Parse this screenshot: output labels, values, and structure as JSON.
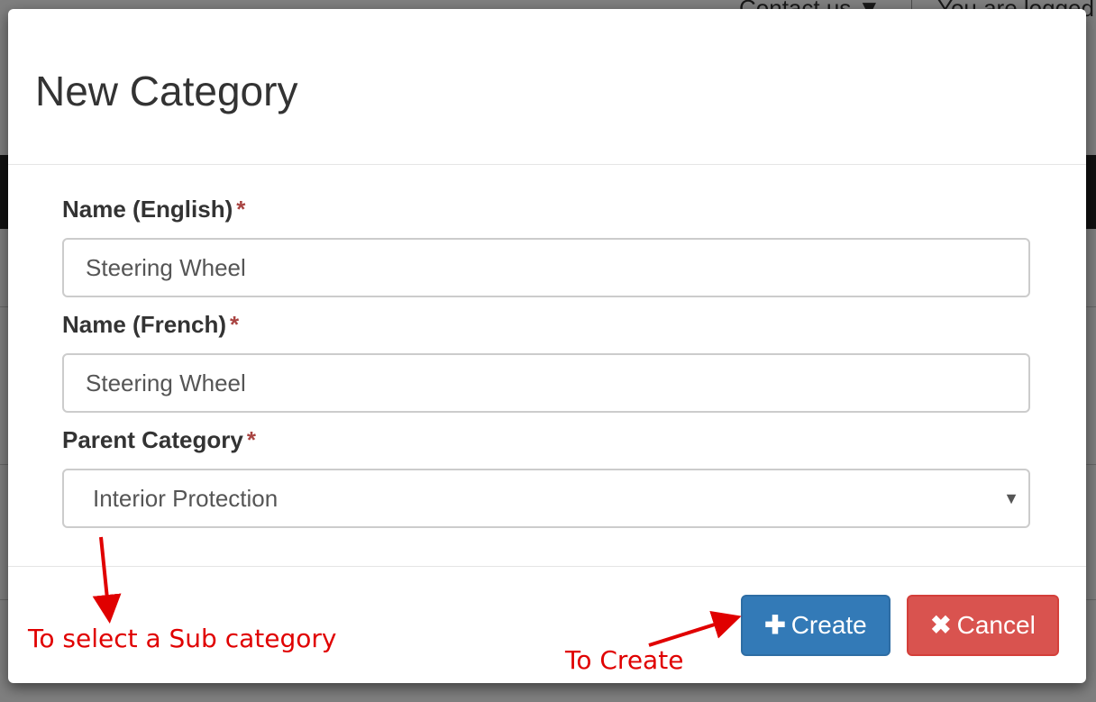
{
  "background": {
    "contact_text": "Contact us",
    "logged_text": "You are logged"
  },
  "modal": {
    "title": "New Category",
    "fields": {
      "name_en": {
        "label": "Name (English)",
        "required_mark": "*",
        "value": "Steering Wheel"
      },
      "name_fr": {
        "label": "Name (French)",
        "required_mark": "*",
        "value": "Steering Wheel"
      },
      "parent": {
        "label": "Parent Category",
        "required_mark": "*",
        "selected": "Interior Protection"
      }
    },
    "buttons": {
      "create": {
        "icon": "plus-icon",
        "label": "Create"
      },
      "cancel": {
        "icon": "x-icon",
        "label": "Cancel"
      }
    }
  },
  "annotations": {
    "sub_category": "To select a Sub category",
    "create": "To Create",
    "color": "#e00000"
  }
}
